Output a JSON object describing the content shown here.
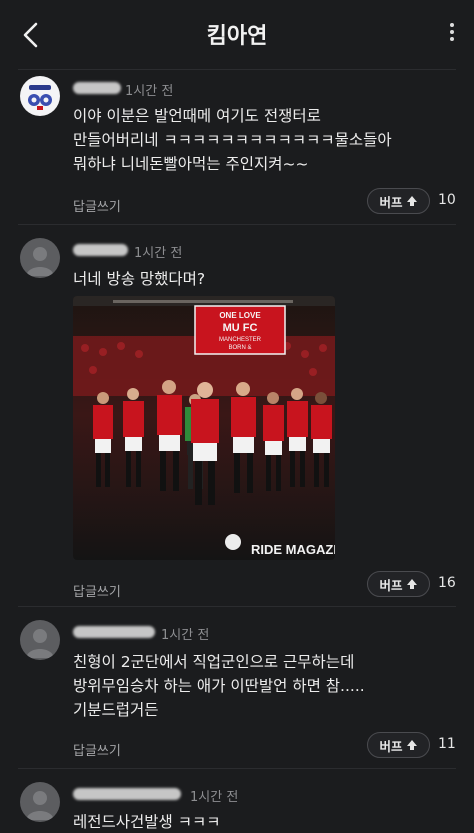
{
  "header": {
    "title": "킴아연"
  },
  "comments": [
    {
      "time": "1시간 전",
      "text": "이야 이분은 발언때메 여기도 전쟁터로\n만들어버리네 ㅋㅋㅋㅋㅋㅋㅋㅋㅋㅋㅋㅋ물소들아\n뭐하냐 니네돈빨아먹는 주인지켜~~",
      "reply_label": "답글쓰기",
      "buff_label": "버프",
      "buff_count": "10"
    },
    {
      "time": "1시간 전",
      "text": "너네 방송 망했다며?",
      "reply_label": "답글쓰기",
      "buff_label": "버프",
      "buff_count": "16",
      "image": {
        "banner_text": [
          "ONE LOVE",
          "MU FC",
          "MANCHESTER",
          "BORN &"
        ],
        "watermark": "RIDE MAGAZINE"
      }
    },
    {
      "time": "1시간 전",
      "text": "친형이 2군단에서 직업군인으로 근무하는데\n방위무임승차 하는 애가 이딴발언 하면 참.....\n기분드럽거든",
      "reply_label": "답글쓰기",
      "buff_label": "버프",
      "buff_count": "11"
    },
    {
      "time": "1시간 전",
      "text": "레전드사건발생 ㅋㅋㅋ"
    }
  ],
  "colors": {
    "background": "#1b1c1e",
    "jersey_red": "#c8141e",
    "muted_text": "#8d8e91"
  },
  "icons": [
    "back-arrow-icon",
    "more-vertical-icon",
    "up-arrow-icon"
  ]
}
